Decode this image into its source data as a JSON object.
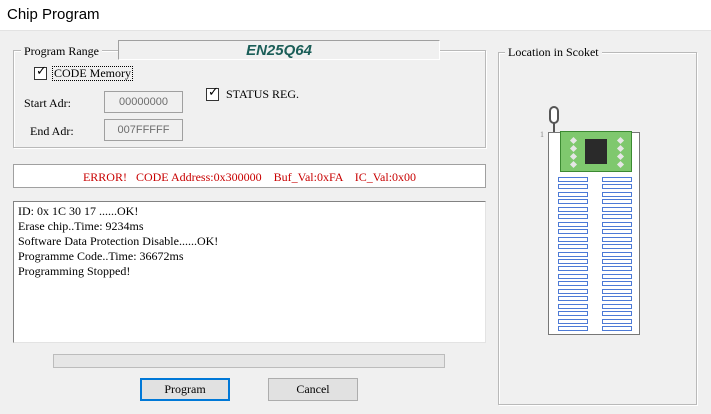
{
  "window": {
    "title": "Chip Program"
  },
  "program_range": {
    "label": "Program Range",
    "chip_name": "EN25Q64",
    "code_memory": {
      "label": "CODE Memory",
      "checked": true
    },
    "status_reg": {
      "label": "STATUS REG.",
      "checked": true
    },
    "start_adr": {
      "label": "Start Adr:",
      "value": "00000000"
    },
    "end_adr": {
      "label": "End Adr:",
      "value": "007FFFFF"
    }
  },
  "error": {
    "text": "ERROR!   CODE Address:0x300000    Buf_Val:0xFA    IC_Val:0x00"
  },
  "log": {
    "lines": [
      "ID: 0x 1C 30 17 ......OK!",
      "Erase chip..Time: 9234ms",
      "Software Data Protection Disable......OK!",
      "Programme Code..Time: 36672ms",
      "Programming Stopped!"
    ]
  },
  "progress": {
    "fraction": 0
  },
  "buttons": {
    "program": "Program",
    "cancel": "Cancel"
  },
  "socket": {
    "label": "Location in Scoket",
    "pin1_mark": "1"
  },
  "colors": {
    "error": "#c80000",
    "chip_name": "#1b5e58",
    "socket_slot": "#4d7ad6",
    "chip_board": "#7fc86e"
  }
}
